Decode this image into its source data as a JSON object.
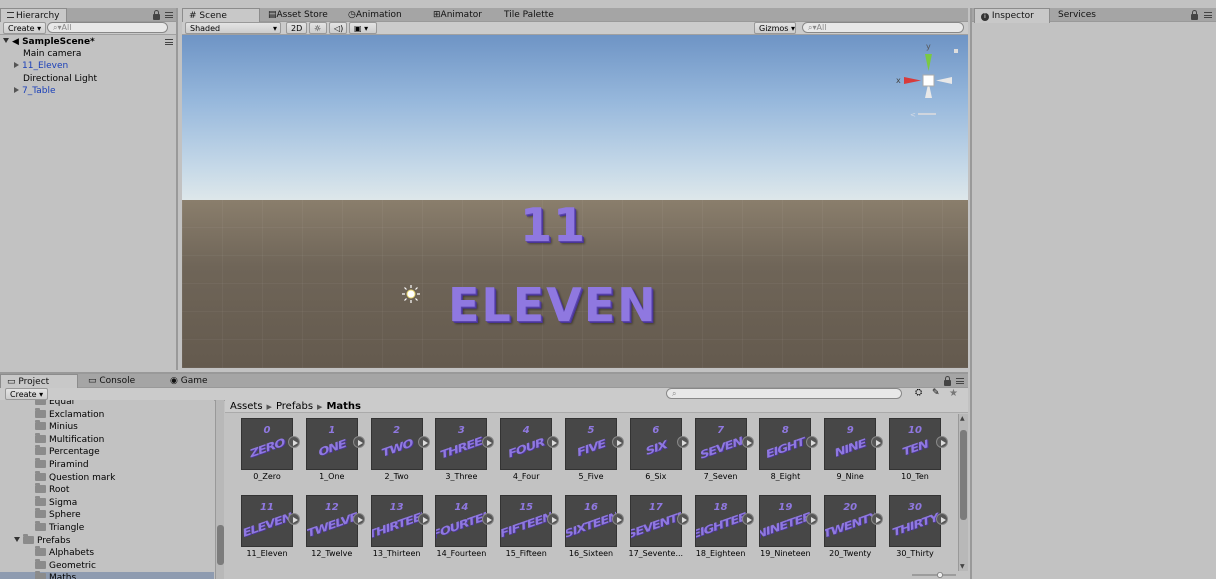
{
  "hierarchy": {
    "tab_label": "Hierarchy",
    "create_label": "Create",
    "search_placeholder": "All",
    "scene_name": "SampleScene*",
    "items": [
      {
        "label": "Main camera",
        "expandable": false,
        "prefab": false
      },
      {
        "label": "11_Eleven",
        "expandable": true,
        "prefab": true
      },
      {
        "label": "Directional Light",
        "expandable": false,
        "prefab": false
      },
      {
        "label": "7_Table",
        "expandable": true,
        "prefab": true
      }
    ]
  },
  "scene": {
    "tabs": [
      "Scene",
      "Asset Store",
      "Animation",
      "Animator",
      "Tile Palette"
    ],
    "shading_mode": "Shaded",
    "mode_2d": "2D",
    "gizmos_label": "Gizmos",
    "search_placeholder": "All",
    "gizmo_axes": {
      "y": "y",
      "x": "x"
    },
    "scene_objects": {
      "number": "11",
      "word": "ELEVEN"
    }
  },
  "inspector": {
    "tabs": [
      "Inspector",
      "Services"
    ]
  },
  "project": {
    "tabs": [
      "Project",
      "Console",
      "Game"
    ],
    "create_label": "Create",
    "folders": [
      {
        "label": "Equal",
        "level": 2
      },
      {
        "label": "Exclamation",
        "level": 2
      },
      {
        "label": "Minius",
        "level": 2
      },
      {
        "label": "Multification",
        "level": 2
      },
      {
        "label": "Percentage",
        "level": 2
      },
      {
        "label": "Piramind",
        "level": 2
      },
      {
        "label": "Question mark",
        "level": 2
      },
      {
        "label": "Root",
        "level": 2
      },
      {
        "label": "Sigma",
        "level": 2
      },
      {
        "label": "Sphere",
        "level": 2
      },
      {
        "label": "Triangle",
        "level": 2
      },
      {
        "label": "Prefabs",
        "level": 1
      },
      {
        "label": "Alphabets",
        "level": 2
      },
      {
        "label": "Geometric",
        "level": 2
      },
      {
        "label": "Maths",
        "level": 2
      }
    ],
    "breadcrumb": [
      "Assets",
      "Prefabs",
      "Maths"
    ],
    "assets_row1": [
      {
        "label": "0_Zero",
        "num": "0",
        "word": "ZERO"
      },
      {
        "label": "1_One",
        "num": "1",
        "word": "ONE"
      },
      {
        "label": "2_Two",
        "num": "2",
        "word": "TWO"
      },
      {
        "label": "3_Three",
        "num": "3",
        "word": "THREE"
      },
      {
        "label": "4_Four",
        "num": "4",
        "word": "FOUR"
      },
      {
        "label": "5_Five",
        "num": "5",
        "word": "FIVE"
      },
      {
        "label": "6_Six",
        "num": "6",
        "word": "SIX"
      },
      {
        "label": "7_Seven",
        "num": "7",
        "word": "SEVEN"
      },
      {
        "label": "8_Eight",
        "num": "8",
        "word": "EIGHT"
      },
      {
        "label": "9_Nine",
        "num": "9",
        "word": "NINE"
      },
      {
        "label": "10_Ten",
        "num": "10",
        "word": "TEN"
      }
    ],
    "assets_row2": [
      {
        "label": "11_Eleven",
        "num": "11",
        "word": "ELEVEN"
      },
      {
        "label": "12_Twelve",
        "num": "12",
        "word": "TWELVE"
      },
      {
        "label": "13_Thirteen",
        "num": "13",
        "word": "THIRTEEN"
      },
      {
        "label": "14_Fourteen",
        "num": "14",
        "word": "FOURTEEN"
      },
      {
        "label": "15_Fifteen",
        "num": "15",
        "word": "FIFTEEN"
      },
      {
        "label": "16_Sixteen",
        "num": "16",
        "word": "SIXTEEN"
      },
      {
        "label": "17_Sevente...",
        "num": "17",
        "word": "SEVENTEEN"
      },
      {
        "label": "18_Eighteen",
        "num": "18",
        "word": "EIGHTEEN"
      },
      {
        "label": "19_Nineteen",
        "num": "19",
        "word": "NINETEEN"
      },
      {
        "label": "20_Twenty",
        "num": "20",
        "word": "TWENTY"
      },
      {
        "label": "30_Thirty",
        "num": "30",
        "word": "THIRTY"
      }
    ]
  },
  "colors": {
    "prefab_text": "#1a3fb8",
    "scene_text": "#8f78e0",
    "panel_bg": "#c2c2c2"
  }
}
